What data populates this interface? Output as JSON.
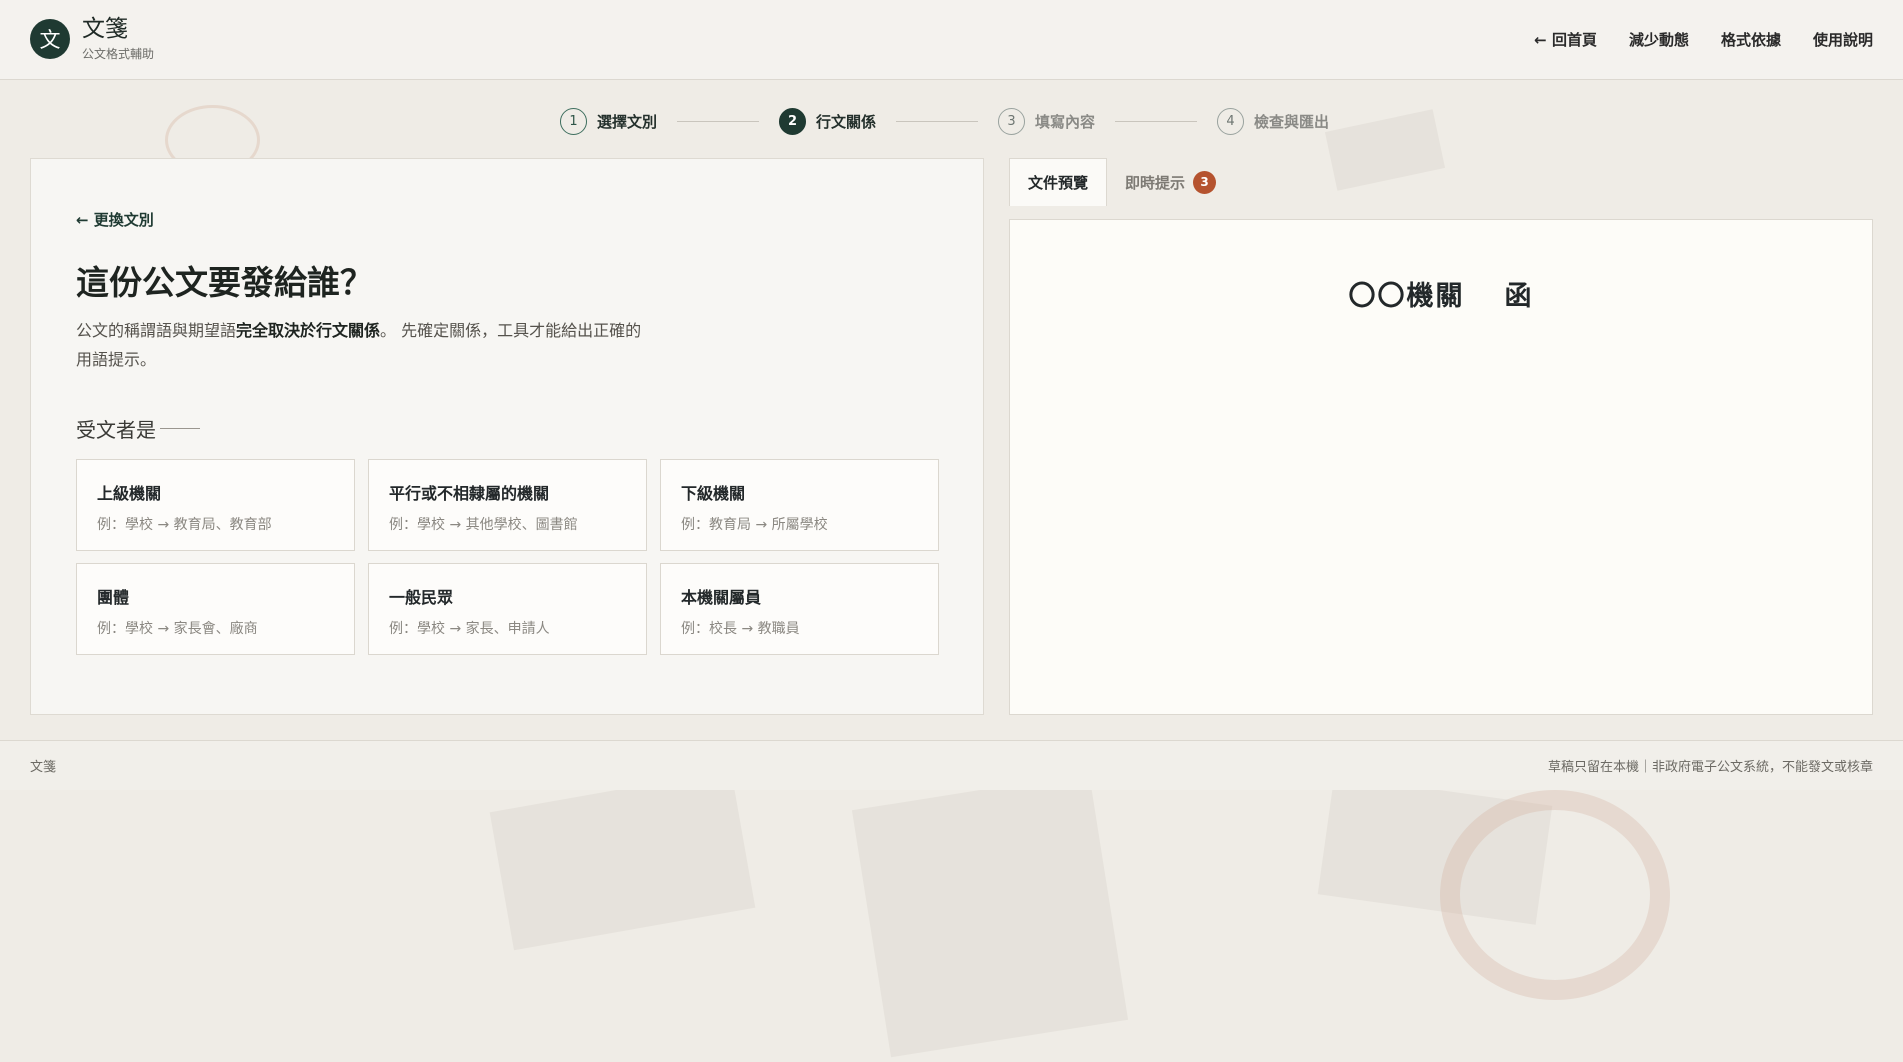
{
  "brand": {
    "logo_char": "文",
    "title": "文箋",
    "subtitle": "公文格式輔助"
  },
  "nav": [
    {
      "label": "← 回首頁"
    },
    {
      "label": "減少動態"
    },
    {
      "label": "格式依據"
    },
    {
      "label": "使用說明"
    }
  ],
  "stepper": [
    {
      "num": "1",
      "label": "選擇文別",
      "state": "done"
    },
    {
      "num": "2",
      "label": "行文關係",
      "state": "active"
    },
    {
      "num": "3",
      "label": "填寫內容",
      "state": "pending"
    },
    {
      "num": "4",
      "label": "檢查與匯出",
      "state": "pending"
    }
  ],
  "main": {
    "back_label": "← 更換文別",
    "question": "這份公文要發給誰？",
    "desc_before": "公文的稱謂語與期望語",
    "desc_bold": "完全取決於行文關係",
    "desc_after": "。 先確定關係，工具才能給出正確的用語提示。",
    "section_label": "受文者是",
    "options": [
      {
        "title": "上級機關",
        "example": "例：學校 → 教育局、教育部"
      },
      {
        "title": "平行或不相隸屬的機關",
        "example": "例：學校 → 其他學校、圖書館"
      },
      {
        "title": "下級機關",
        "example": "例：教育局 → 所屬學校"
      },
      {
        "title": "團體",
        "example": "例：學校 → 家長會、廠商"
      },
      {
        "title": "一般民眾",
        "example": "例：學校 → 家長、申請人"
      },
      {
        "title": "本機關屬員",
        "example": "例：校長 → 教職員"
      }
    ]
  },
  "preview": {
    "tabs": [
      {
        "label": "文件預覽"
      },
      {
        "label": "即時提示",
        "badge": "3"
      }
    ],
    "doc_title_org": "〇〇機關",
    "doc_title_type": "函"
  },
  "footer": {
    "left": "文箋",
    "right": "草稿只留在本機｜非政府電子公文系統，不能發文或核章"
  },
  "colors": {
    "accent": "#1f3a32",
    "badge": "#b5532f",
    "background": "#efece6"
  }
}
